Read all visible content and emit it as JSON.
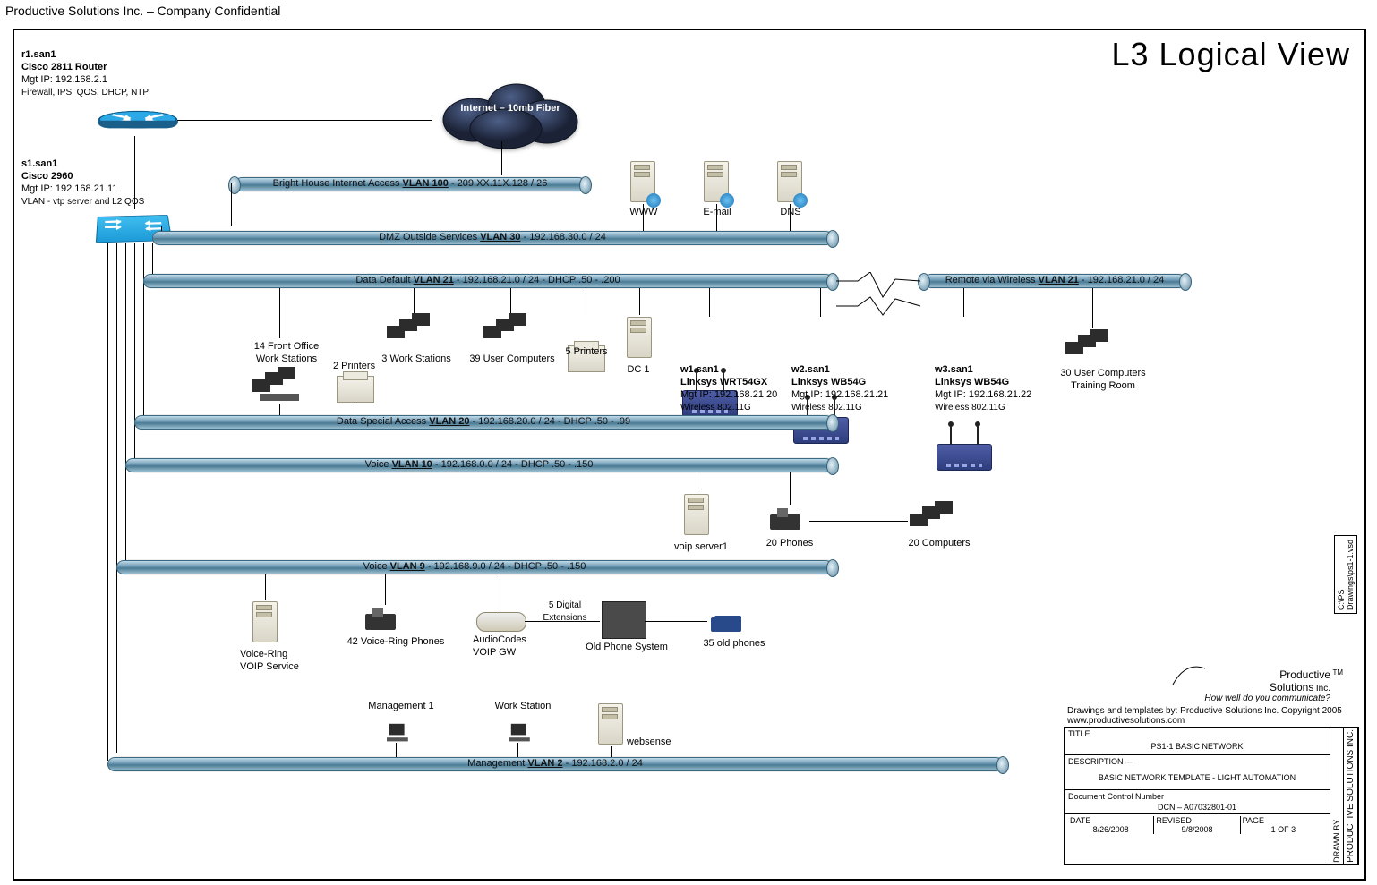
{
  "header": "Productive Solutions Inc. – Company Confidential",
  "view_title": "L3 Logical View",
  "router": {
    "name": "r1.san1",
    "model": "Cisco 2811 Router",
    "mgmt": "Mgt IP: 192.168.2.1",
    "features": "Firewall, IPS, QOS, DHCP, NTP"
  },
  "switch": {
    "name": "s1.san1",
    "model": "Cisco 2960",
    "mgmt": "Mgt IP: 192.168.21.11",
    "features": "VLAN - vtp server and L2 QOS"
  },
  "cloud": {
    "label": "Internet – 10mb Fiber"
  },
  "vlans": {
    "v100": "Bright House Internet Access <u>VLAN 100</u> - 209.XX.11X.128 / 26",
    "v30": "DMZ Outside Services <u>VLAN 30</u> - 192.168.30.0 / 24",
    "v21": "Data Default <u>VLAN 21</u> - 192.168.21.0 / 24  - DHCP .50 - .200",
    "v21r": "Remote via Wireless <u>VLAN 21</u> - 192.168.21.0 / 24",
    "v20": "Data Special Access <u>VLAN 20</u> - 192.168.20.0 / 24  - DHCP .50 - .99",
    "v10": "Voice <u>VLAN 10</u> - 192.168.0.0 / 24  - DHCP .50 - .150",
    "v9": "Voice <u>VLAN 9</u> - 192.168.9.0 / 24  - DHCP .50 - .150",
    "v2": "Management <u>VLAN 2</u> - 192.168.2.0 / 24"
  },
  "dmz": {
    "www": "WWW",
    "email": "E-mail",
    "dns": "DNS"
  },
  "dd": {
    "ws14a": "14 Front Office",
    "ws14b": "Work Stations",
    "pr2": "2 Printers",
    "ws3": "3 Work Stations",
    "uc39": "39 User Computers",
    "pr5": "5 Printers",
    "dc1": "DC 1",
    "w1_name": "w1.san1",
    "w1_model": "Linksys WRT54GX",
    "w1_ip": "Mgt IP: 192.168.21.20",
    "w1_proto": "Wireless 802.11G",
    "w2_name": "w2.san1",
    "w2_model": "Linksys WB54G",
    "w2_ip": "Mgt IP: 192.168.21.21",
    "w2_proto": "Wireless 802.11G",
    "w3_name": "w3.san1",
    "w3_model": "Linksys WB54G",
    "w3_ip": "Mgt IP: 192.168.21.22",
    "w3_proto": "Wireless 802.11G",
    "uc30a": "30 User Computers",
    "uc30b": "Training Room"
  },
  "voice10": {
    "voip_server": "voip server1",
    "phones20": "20 Phones",
    "pcs20": "20 Computers"
  },
  "voice9": {
    "vr1": "Voice-Ring",
    "vr2": "VOIP Service",
    "vrphones": "42 Voice-Ring Phones",
    "ac1": "AudioCodes",
    "ac2": "VOIP GW",
    "digext": "5 Digital\nExtensions",
    "old": "Old Phone System",
    "oldphones": "35 old phones"
  },
  "mgmt": {
    "m1": "Management 1",
    "ws": "Work Station",
    "websense": "websense"
  },
  "titleblock": {
    "logo_name": "Productive\nSolutions",
    "logo_suffix": "Inc.",
    "slogan": "How well do you communicate?",
    "credit": "Drawings and templates by: Productive Solutions Inc. Copyright 2005\nwww.productivesolutions.com",
    "title_lbl": "TITLE",
    "title_val": "PS1-1 BASIC NETWORK",
    "desc_lbl": "DESCRIPTION —",
    "desc_val": "BASIC NETWORK TEMPLATE - LIGHT AUTOMATION",
    "dcn_lbl": "Document Control Number",
    "dcn_val": "DCN – A07032801-01",
    "date_lbl": "DATE",
    "date_val": "8/26/2008",
    "rev_lbl": "REVISED",
    "rev_val": "9/8/2008",
    "page_lbl": "PAGE",
    "page_val": "1 OF 3",
    "drawn_lbl": "DRAWN BY",
    "drawn_val": "PRODUCTIVE SOLUTIONS INC.",
    "file": "C:\\PS Drawings\\ps1-1.vsd"
  }
}
